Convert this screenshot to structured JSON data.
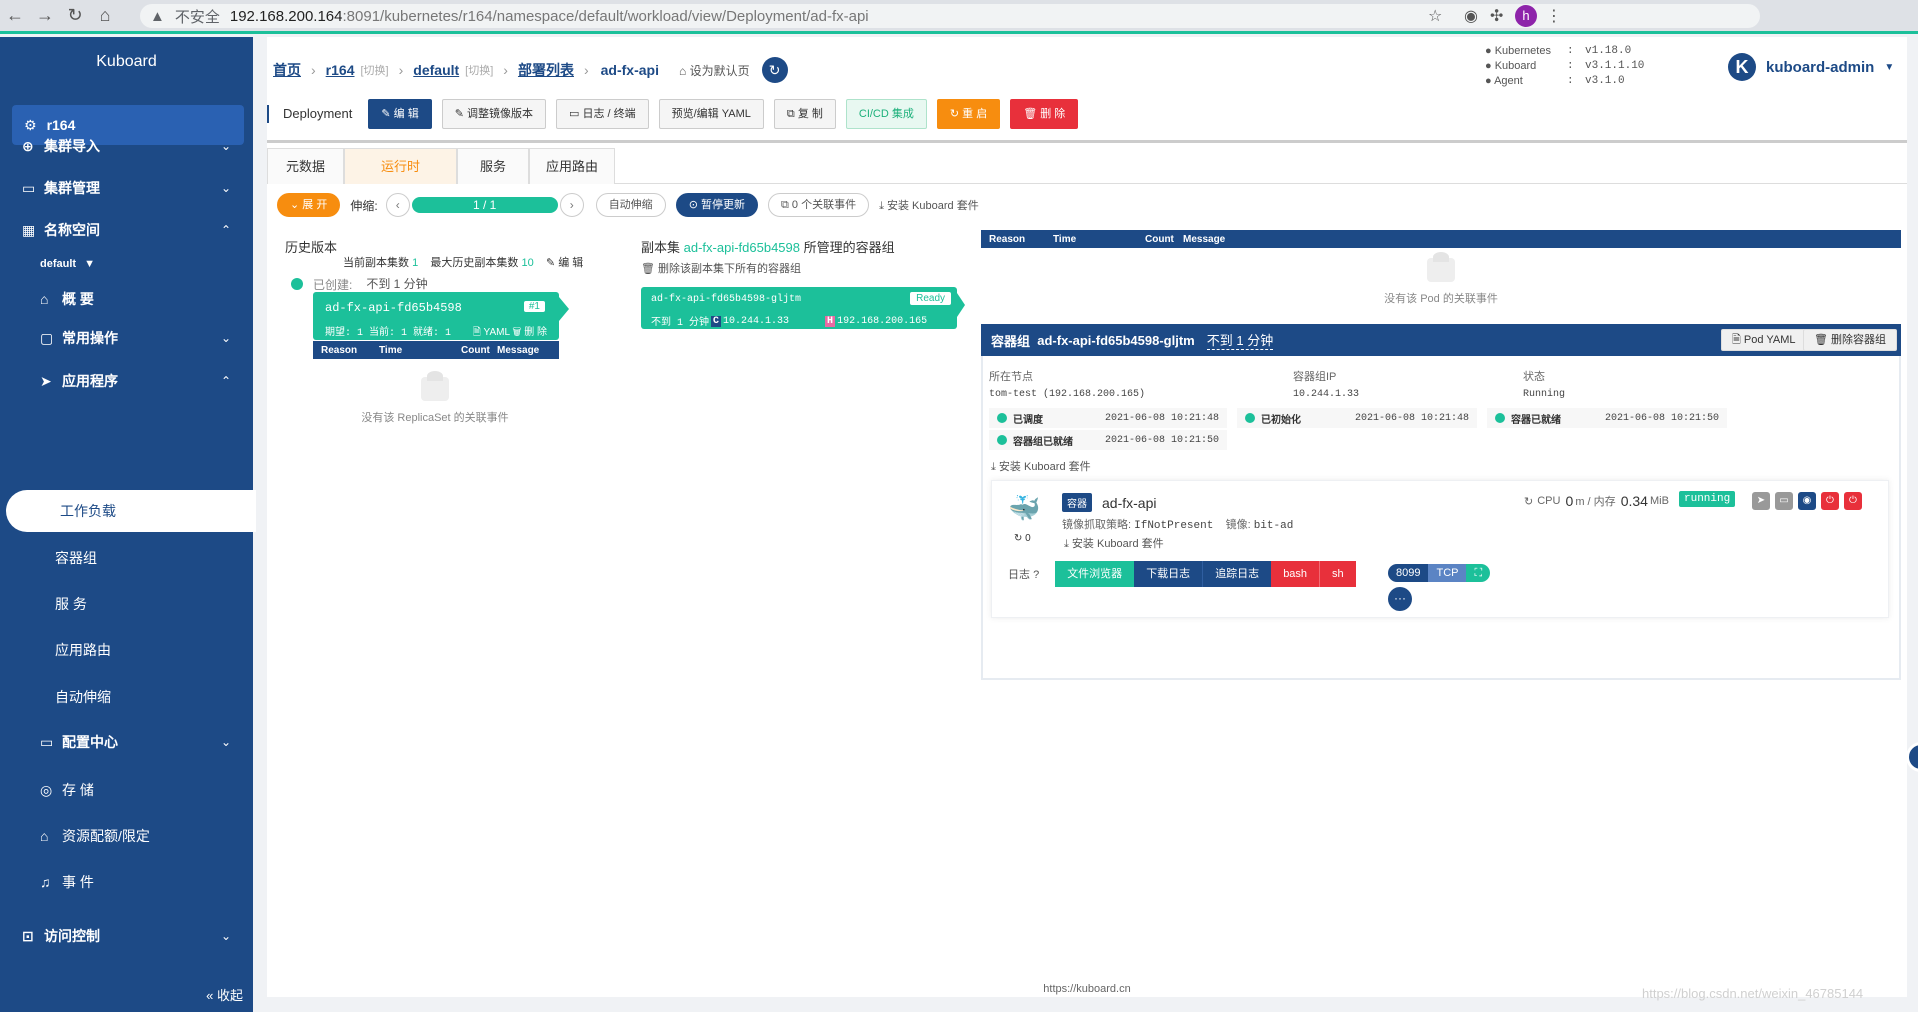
{
  "browser": {
    "insecure": "不安全",
    "host": "192.168.200.164",
    "path": ":8091/kubernetes/r164/namespace/default/workload/view/Deployment/ad-fx-api",
    "avatar": "h"
  },
  "sidebar": {
    "brand": "Kuboard",
    "cluster": "r164",
    "items": {
      "import": "集群导入",
      "manage": "集群管理",
      "namespace": "名称空间",
      "ns_default": "default",
      "overview": "概 要",
      "common_ops": "常用操作",
      "apps": "应用程序",
      "workload": "工作负载",
      "pods": "容器组",
      "services": "服 务",
      "ingress": "应用路由",
      "autoscale": "自动伸缩",
      "config": "配置中心",
      "storage": "存 储",
      "quota": "资源配额/限定",
      "events": "事 件",
      "access": "访问控制"
    },
    "collapse": "« 收起"
  },
  "breadcrumb": {
    "home": "首页",
    "cluster": "r164",
    "switch1": "[切换]",
    "ns": "default",
    "switch2": "[切换]",
    "list": "部署列表",
    "current": "ad-fx-api",
    "set_default": "设为默认页"
  },
  "versions": [
    {
      "k": "Kubernetes",
      "v": "v1.18.0"
    },
    {
      "k": "Kuboard",
      "v": "v3.1.1.10"
    },
    {
      "k": "Agent",
      "v": "v3.1.0"
    }
  ],
  "user": {
    "initial": "K",
    "name": "kuboard-admin"
  },
  "toolbar": {
    "kind": "Deployment",
    "edit": "编 辑",
    "adjust_image": "调整镜像版本",
    "logs": "日志 / 终端",
    "yaml": "预览/编辑 YAML",
    "copy": "复 制",
    "cicd": "CI/CD 集成",
    "restart": "重 启",
    "delete": "删 除"
  },
  "tabs": [
    "元数据",
    "运行时",
    "服务",
    "应用路由"
  ],
  "controls": {
    "expand": "展 开",
    "scale_label": "伸缩:",
    "scale_value": "1 / 1",
    "autoscale": "自动伸缩",
    "pause": "暂停更新",
    "events": "0 个关联事件",
    "install": "安装 Kuboard 套件"
  },
  "history": {
    "title": "历史版本",
    "current_label": "当前副本集数",
    "current_val": "1",
    "max_label": "最大历史副本集数",
    "max_val": "10",
    "edit": "编 辑",
    "created": "已创建:",
    "ago": "不到 1 分钟",
    "rs_name": "ad-fx-api-fd65b4598",
    "rs_badge": "#1",
    "rs_counts": "期望: 1 当前: 1 就绪: 1",
    "rs_yaml": "YAML",
    "rs_delete": "删 除",
    "empty": "没有该 ReplicaSet 的关联事件"
  },
  "events_header": {
    "reason": "Reason",
    "time": "Time",
    "count": "Count",
    "message": "Message"
  },
  "rs_pods": {
    "title_prefix": "副本集",
    "title_rs": "ad-fx-api-fd65b4598",
    "title_suffix": "所管理的容器组",
    "delete_all": "删除该副本集下所有的容器组",
    "pod_name": "ad-fx-api-fd65b4598-gljtm",
    "ready": "Ready",
    "ago": "不到 1 分钟",
    "c_tag": "C",
    "pod_ip": "10.244.1.33",
    "h_tag": "H",
    "host_ip": "192.168.200.165"
  },
  "pod": {
    "empty": "没有该 Pod 的关联事件",
    "header_label": "容器组",
    "name": "ad-fx-api-fd65b4598-gljtm",
    "ago": "不到 1 分钟",
    "pod_yaml": "Pod YAML",
    "delete": "删除容器组",
    "node_label": "所在节点",
    "node_val": "tom-test  (192.168.200.165)",
    "ip_label": "容器组IP",
    "ip_val": "10.244.1.33",
    "status_label": "状态",
    "status_val": "Running",
    "conditions": [
      {
        "name": "已调度",
        "time": "2021-06-08 10:21:48"
      },
      {
        "name": "已初始化",
        "time": "2021-06-08 10:21:48"
      },
      {
        "name": "容器已就绪",
        "time": "2021-06-08 10:21:50"
      },
      {
        "name": "容器组已就绪",
        "time": "2021-06-08 10:21:50"
      }
    ],
    "install": "安装 Kuboard 套件"
  },
  "container": {
    "tag": "容器",
    "name": "ad-fx-api",
    "restarts": "0",
    "policy_label": "镜像抓取策略:",
    "policy": "IfNotPresent",
    "image_label": "镜像:",
    "image": "bit-ad",
    "cpu_label": "CPU",
    "cpu_val": "0",
    "cpu_unit": "m / 内存",
    "mem_val": "0.34",
    "mem_unit": "MiB",
    "state": "running",
    "install": "安装 Kuboard 套件",
    "logs_label": "日志",
    "buttons": {
      "files": "文件浏览器",
      "download": "下载日志",
      "follow": "追踪日志",
      "bash": "bash",
      "sh": "sh"
    },
    "port": "8099",
    "protocol": "TCP",
    "more": "···"
  },
  "footer": "https://kuboard.cn",
  "watermark": "https://blog.csdn.net/weixin_46785144",
  "colors": {
    "navy": "#1d4a86",
    "green": "#1cc09a",
    "orange": "#f78d0f",
    "red": "#e8303b"
  }
}
